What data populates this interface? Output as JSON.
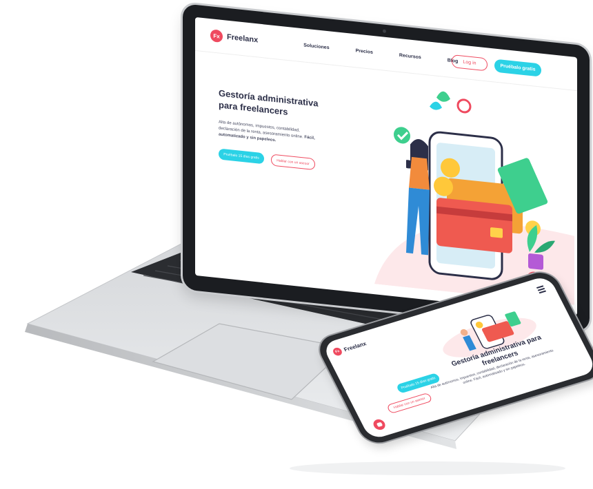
{
  "colors": {
    "brand_red": "#ef4a5f",
    "accent_cyan": "#2bd2e6",
    "text_dark": "#2c2f48",
    "hero_blush": "#fde8ea"
  },
  "laptop": {
    "logo_badge": "Fx",
    "logo_text": "Freelanx",
    "nav": [
      "Soluciones",
      "Precios",
      "Recursos",
      "Blog"
    ],
    "login_label": "Log in",
    "try_label": "Pruébalo gratis",
    "hero_title": "Gestoría administrativa para freelancers",
    "hero_text": "Alta de autónomos, impuestos, contabilidad, declaración de la renta, asesoramiento online.",
    "hero_text_bold": "Fácil, automatizado y sin papeleos.",
    "cta_primary": "Pruébalo 15 días gratis",
    "cta_secondary": "Hablar con un asesor",
    "chat_icon": "chat-bubble-icon"
  },
  "phone": {
    "logo_badge": "Fx",
    "logo_text": "Freelanx",
    "menu_icon": "menu-icon",
    "hero_title": "Gestoría administrativa para freelancers",
    "hero_text": "Alta de autónomos, impuestos, contabilidad, declaración de la renta, asesoramiento online. Fácil, automatizado y sin papeleos.",
    "cta_primary": "Pruébalo 15 días gratis",
    "cta_secondary": "Hablar con un asesor",
    "chat_icon": "chat-bubble-icon"
  }
}
